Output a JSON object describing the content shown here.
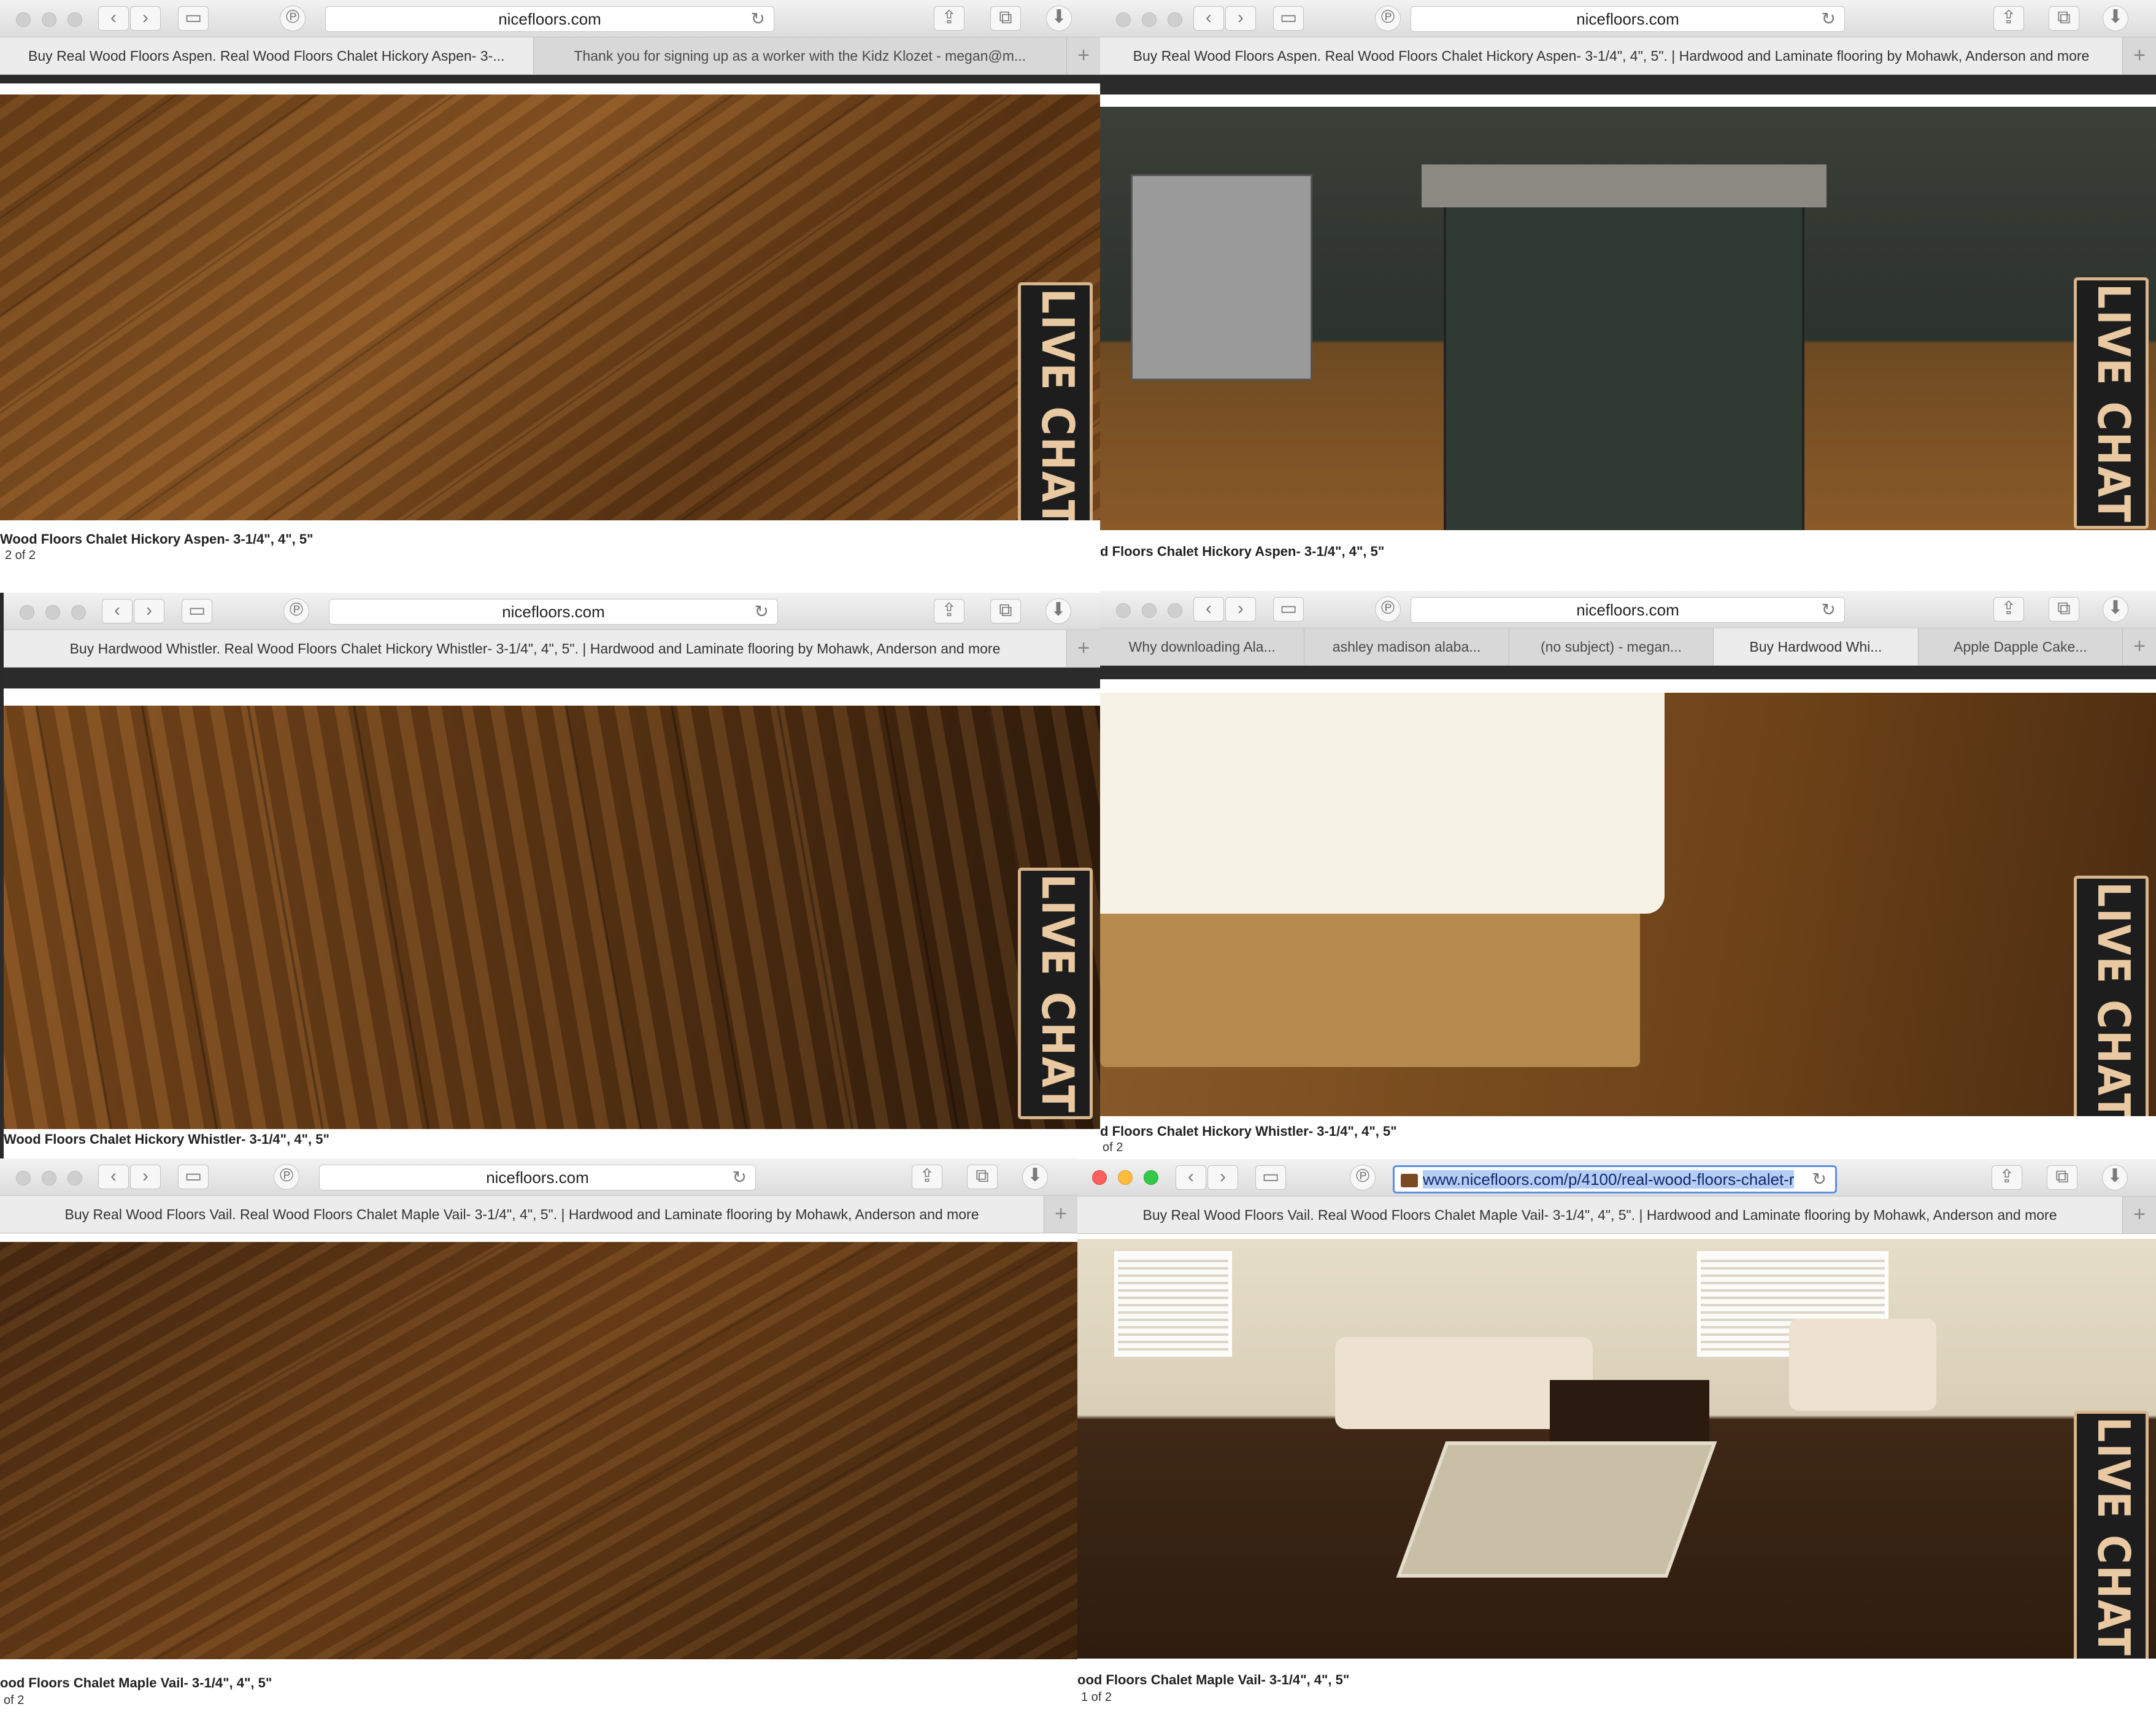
{
  "windows": [
    {
      "id": "w1",
      "address": "nicefloors.com",
      "tabs": [
        "Buy Real Wood Floors Aspen. Real Wood Floors Chalet Hickory Aspen- 3-...",
        "Thank you for signing up as a worker with the Kidz Klozet - megan@m..."
      ],
      "caption": "Wood Floors Chalet Hickory Aspen- 3-1/4\", 4\", 5\"",
      "pager": "2 of 2",
      "live_chat": "LIVE CHAT"
    },
    {
      "id": "w2",
      "address": "nicefloors.com",
      "tabs": [
        "Buy Real Wood Floors Aspen. Real Wood Floors Chalet Hickory Aspen- 3-1/4\", 4\", 5\". | Hardwood and Laminate flooring by Mohawk, Anderson and more"
      ],
      "caption": "d Floors Chalet Hickory Aspen- 3-1/4\", 4\", 5\"",
      "pager": "",
      "live_chat": "LIVE CHAT"
    },
    {
      "id": "w3",
      "address": "nicefloors.com",
      "tabs": [
        "Buy Hardwood Whistler. Real Wood Floors Chalet Hickory Whistler- 3-1/4\", 4\", 5\". | Hardwood and Laminate flooring by Mohawk, Anderson and more"
      ],
      "caption": "Wood Floors Chalet Hickory Whistler- 3-1/4\", 4\", 5\"",
      "pager": "",
      "live_chat": "LIVE CHAT"
    },
    {
      "id": "w4",
      "address": "nicefloors.com",
      "tabs": [
        "Why downloading Ala...",
        "ashley madison alaba...",
        "(no subject) - megan...",
        "Buy Hardwood Whi...",
        "Apple Dapple Cake..."
      ],
      "caption": "d Floors Chalet Hickory Whistler- 3-1/4\", 4\", 5\"",
      "pager": "of 2",
      "live_chat": "LIVE CHAT"
    },
    {
      "id": "w5",
      "address": "nicefloors.com",
      "tabs": [
        "Buy Real Wood Floors Vail. Real Wood Floors Chalet Maple Vail- 3-1/4\", 4\", 5\". | Hardwood and Laminate flooring by Mohawk, Anderson and more"
      ],
      "caption": "ood Floors Chalet Maple Vail- 3-1/4\", 4\", 5\"",
      "pager": "of 2",
      "live_chat": ""
    },
    {
      "id": "w6",
      "address": "www.nicefloors.com/p/4100/real-wood-floors-chalet-r",
      "tabs": [
        "Buy Real Wood Floors Vail. Real Wood Floors Chalet Maple Vail- 3-1/4\", 4\", 5\". | Hardwood and Laminate flooring by Mohawk, Anderson and more"
      ],
      "caption": "ood Floors Chalet Maple Vail- 3-1/4\", 4\", 5\"",
      "pager": "1 of 2",
      "live_chat": "LIVE CHAT"
    }
  ],
  "icons": {
    "back": "chevron-left-icon",
    "forward": "chevron-right-icon",
    "sidebar": "sidebar-icon",
    "pinterest": "pinterest-icon",
    "reload": "reload-icon",
    "share": "share-icon",
    "tabs": "tabs-overview-icon",
    "download": "download-icon",
    "new_tab": "plus-icon"
  },
  "glyphs": {
    "back": "‹",
    "forward": "›",
    "sidebar": "▭",
    "pinterest": "℗",
    "reload": "↻",
    "share": "⇪",
    "tabs": "⧉",
    "download": "⬇",
    "plus": "+"
  },
  "colors": {
    "accent_selection": "#b4cdf5",
    "live_chat_text": "#e9c9a2",
    "live_chat_border": "#d8b48a"
  }
}
